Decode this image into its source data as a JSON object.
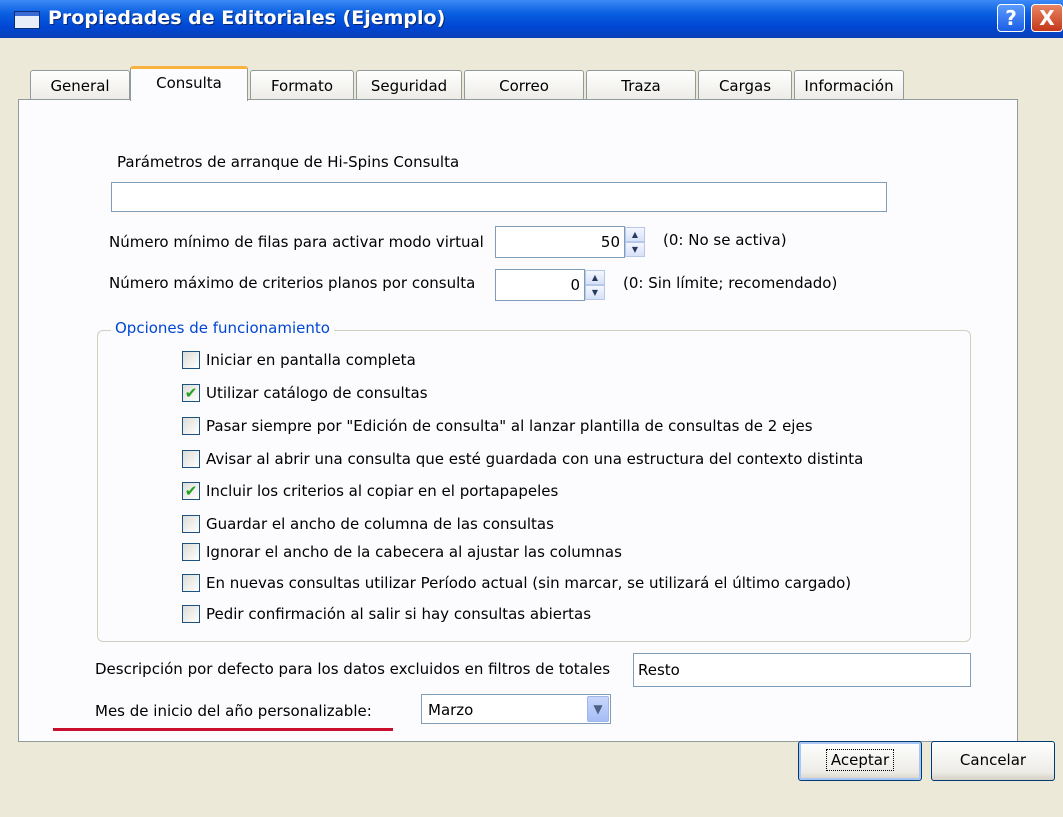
{
  "window": {
    "title": "Propiedades de Editoriales (Ejemplo)",
    "help_button": "?",
    "close_button": "X"
  },
  "tabs": [
    {
      "label": "General",
      "active": false
    },
    {
      "label": "Consulta",
      "active": true
    },
    {
      "label": "Formato",
      "active": false
    },
    {
      "label": "Seguridad",
      "active": false
    },
    {
      "label": "Correo",
      "active": false
    },
    {
      "label": "Traza",
      "active": false
    },
    {
      "label": "Cargas",
      "active": false
    },
    {
      "label": "Información",
      "active": false
    }
  ],
  "consulta": {
    "startup_params_label": "Parámetros de arranque de Hi-Spins Consulta",
    "startup_params_value": "",
    "min_rows_label": "Número mínimo de filas para activar modo virtual",
    "min_rows_value": "50",
    "min_rows_hint": "(0: No se activa)",
    "max_criteria_label": "Número máximo de criterios planos por consulta",
    "max_criteria_value": "0",
    "max_criteria_hint": "(0: Sin límite; recomendado)",
    "options_group_title": "Opciones de funcionamiento",
    "options": [
      {
        "label": "Iniciar en pantalla completa",
        "checked": false
      },
      {
        "label": "Utilizar catálogo de consultas",
        "checked": true
      },
      {
        "label": "Pasar siempre por \"Edición de consulta\" al lanzar plantilla de consultas de 2 ejes",
        "checked": false
      },
      {
        "label": "Avisar al abrir una consulta que esté guardada con una estructura del contexto distinta",
        "checked": false
      },
      {
        "label": "Incluir los criterios al copiar en el portapapeles",
        "checked": true
      },
      {
        "label": "Guardar el ancho de columna de las consultas",
        "checked": false
      },
      {
        "label": "Ignorar el ancho de la cabecera al ajustar las columnas",
        "checked": false
      },
      {
        "label": "En nuevas consultas utilizar Período actual (sin marcar, se utilizará el último cargado)",
        "checked": false
      },
      {
        "label": "Pedir confirmación al salir si hay consultas abiertas",
        "checked": false
      }
    ],
    "excluded_desc_label": "Descripción por defecto para los datos excluidos en filtros de totales",
    "excluded_desc_value": "Resto",
    "start_month_label": "Mes de inicio del año personalizable:",
    "start_month_value": "Marzo"
  },
  "buttons": {
    "accept": "Aceptar",
    "cancel": "Cancelar"
  },
  "icons": {
    "window_icon": "app-window-icon",
    "check_mark": "✔",
    "dropdown": "chevron-down-icon"
  },
  "colors": {
    "titlebar": "#0047d4",
    "active_tab_highlight": "#f7b33d",
    "group_title": "#0046d5",
    "annotation_underline": "#c8102e"
  }
}
